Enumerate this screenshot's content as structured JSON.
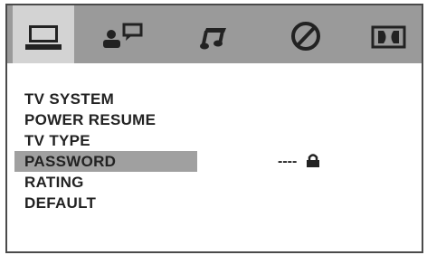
{
  "tabs": [
    {
      "icon": "tv-monitor-icon",
      "active": true
    },
    {
      "icon": "person-speech-icon",
      "active": false
    },
    {
      "icon": "music-note-icon",
      "active": false
    },
    {
      "icon": "slash-circle-icon",
      "active": false
    },
    {
      "icon": "dolby-icon",
      "active": false
    }
  ],
  "menu": {
    "items": [
      {
        "label": "TV SYSTEM"
      },
      {
        "label": "POWER RESUME"
      },
      {
        "label": "TV TYPE"
      },
      {
        "label": "PASSWORD"
      },
      {
        "label": "RATING"
      },
      {
        "label": "DEFAULT"
      }
    ],
    "selected_index": 3
  },
  "password": {
    "value": "----",
    "icon": "lock-icon"
  },
  "colors": {
    "tab_bar": "#9a9a9a",
    "tab_active": "#d3d3d3",
    "selection": "#a0a0a0",
    "text": "#222222"
  }
}
